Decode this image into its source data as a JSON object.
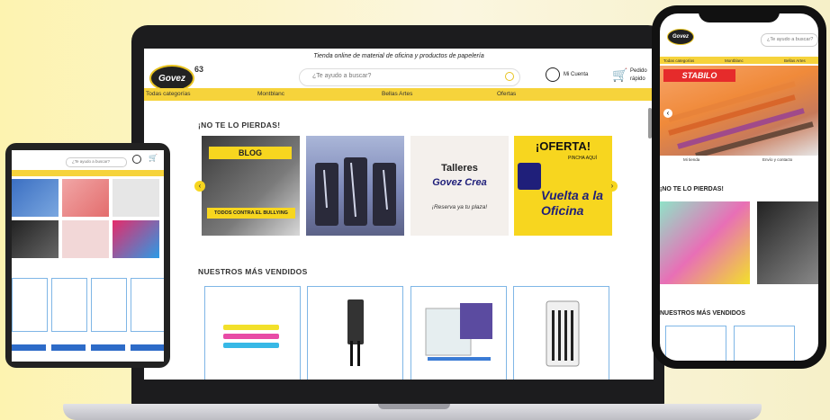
{
  "laptop": {
    "tagline": "Tienda online de material de oficina y productos de papelería",
    "logo_text": "Govez",
    "logo_number": "63",
    "search_placeholder": "¿Te ayudo a buscar?",
    "account_label": "Mi Cuenta",
    "cart_label": "Pedido rápido",
    "nav": [
      "Todas categorías",
      "Montblanc",
      "Bellas Artes",
      "Ofertas"
    ],
    "section1_title": "¡NO TE LO PIERDAS!",
    "blog_label": "BLOG",
    "blog_caption": "TODOS CONTRA EL BULLYING",
    "talleres_line1": "Talleres",
    "talleres_line2": "Govez Crea",
    "talleres_line3": "¡Reserva ya tu plaza!",
    "oferta_title": "¡OFERTA!",
    "oferta_small": "PINCHA AQUÍ",
    "oferta_text": "Vuelta a la Oficina",
    "section2_title": "NUESTROS MÁS VENDIDOS"
  },
  "tablet": {
    "search_placeholder": "¿Te ayudo a buscar?"
  },
  "phone": {
    "logo_text": "Govez",
    "search_placeholder": "¿Te ayudo a buscar?",
    "nav": [
      "Todas categorías",
      "Montblanc",
      "Bellas Artes"
    ],
    "banner_brand": "STABILO",
    "info1": "Mi tienda",
    "info2": "Envío y contacto",
    "section1_title": "¡NO TE LO PIERDAS!",
    "section2_title": "NUESTROS MÁS VENDIDOS"
  },
  "colors": {
    "accent_yellow": "#f6d33b",
    "product_border": "#7fb6e6",
    "device_dark": "#1c1c1e"
  }
}
